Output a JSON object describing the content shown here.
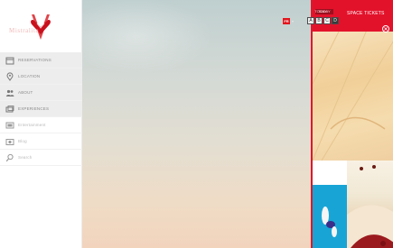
{
  "brand": {
    "name": "Mistralita"
  },
  "menu": [
    {
      "id": "reservations",
      "label": "RESERVATIONS",
      "icon": "calendar-icon",
      "shaded": true,
      "muted": false
    },
    {
      "id": "location",
      "label": "LOCATION",
      "icon": "location-pin-icon",
      "shaded": true,
      "muted": false
    },
    {
      "id": "about",
      "label": "ABOUT",
      "icon": "people-icon",
      "shaded": true,
      "muted": false
    },
    {
      "id": "experiences",
      "label": "EXPERIENCES",
      "icon": "photo-stack-icon",
      "shaded": true,
      "muted": false
    },
    {
      "id": "entertainment",
      "label": "Entertainment",
      "icon": "film-icon",
      "shaded": false,
      "muted": true
    },
    {
      "id": "blog",
      "label": "Blog",
      "icon": "camera-icon",
      "shaded": false,
      "muted": true
    },
    {
      "id": "search",
      "label": "Search",
      "icon": "search-icon",
      "shaded": false,
      "muted": true
    }
  ],
  "language": {
    "current": "FR"
  },
  "panel": {
    "chip": "TODAY",
    "heading": "SPACE TICKETS",
    "colors": {
      "accent": "#e3122b",
      "blue": "#18a5d6"
    }
  },
  "toolbar": {
    "buttons": [
      "A",
      "B",
      "C",
      "D"
    ]
  }
}
